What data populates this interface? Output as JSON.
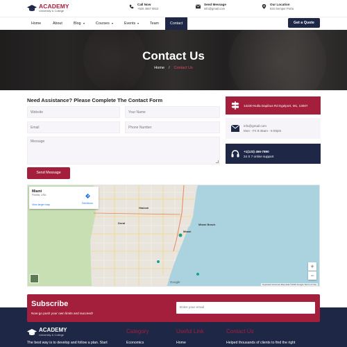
{
  "brand": {
    "name": "ACADEMY",
    "tagline": "University & College"
  },
  "top_info": [
    {
      "title": "Call Now",
      "value": "+526 4567 8910",
      "icon": "phone-icon"
    },
    {
      "title": "Send Message",
      "value": "info@gmail.com",
      "icon": "mail-icon"
    },
    {
      "title": "Our Location",
      "value": "634 Semper Porta",
      "icon": "location-icon"
    }
  ],
  "nav": {
    "items": [
      {
        "label": "Home"
      },
      {
        "label": "About"
      },
      {
        "label": "Blog"
      },
      {
        "label": "Courses"
      },
      {
        "label": "Events"
      },
      {
        "label": "Team"
      },
      {
        "label": "Contact"
      }
    ],
    "quote_button": "Get a Quote"
  },
  "hero": {
    "title": "Contact Us",
    "breadcrumb_home": "Home",
    "breadcrumb_sep": "/",
    "breadcrumb_current": "Contact Us"
  },
  "form": {
    "heading": "Need Assistance? Please Complete The Contact Form",
    "website_placeholder": "Website",
    "name_placeholder": "Your Name",
    "email_placeholder": "Email",
    "phone_placeholder": "Phone Number",
    "message_placeholder": "Message",
    "submit": "Send Message"
  },
  "cards": [
    {
      "line1": "13230 Nulla Dapibus Rd Egelport, M1, 13007",
      "line2": "",
      "bg": "#a41f3b",
      "fg": "#ffffff",
      "icon": "signpost-icon"
    },
    {
      "line1": "info@gmail.com",
      "line2": "Mon - Fri 8:45am - 5:00pm",
      "bg": "#f6f4f8",
      "fg": "#666666",
      "icon": "envelope-icon"
    },
    {
      "line1": "+1(123) 456-7890",
      "line2": "24 X 7 online support",
      "bg": "#1e2746",
      "fg": "#ffffff",
      "icon": "headset-icon"
    }
  ],
  "map": {
    "place": "Miami",
    "region": "Florida, USA",
    "link": "View larger map",
    "directions": "Directions",
    "labels": [
      "Hialeah",
      "Miami",
      "Miami Beach",
      "Doral"
    ],
    "attribution": "Keyboard shortcuts  Map data ©2023 Google  Terms of Use",
    "google": "Google",
    "zoom_in": "+",
    "zoom_out": "−"
  },
  "subscribe": {
    "title": "Subscribe",
    "text": "Now go push your own limits and succeed!",
    "placeholder": "Enter your email"
  },
  "footer": {
    "brand": "ACADEMY",
    "brand_sub": "University & College",
    "about": "The best way is to develop and follow a plan. Start",
    "col2_head": "Category",
    "col2_item": "Economics",
    "col3_head": "Useful Link",
    "col3_item": "Home",
    "col4_head": "Contact Us",
    "col4_item": "Helped thousands of clients to find the right"
  },
  "colors": {
    "accent": "#a41f3b",
    "navy": "#1e2746"
  }
}
